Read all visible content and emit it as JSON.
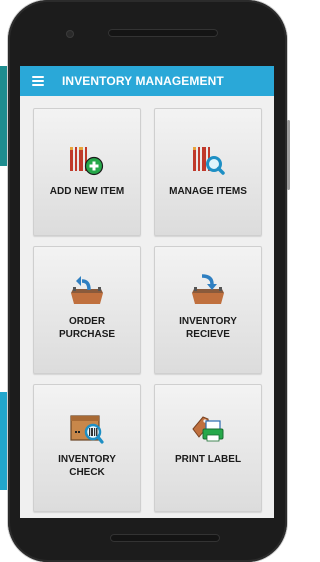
{
  "app": {
    "title": "INVENTORY MANAGEMENT"
  },
  "colors": {
    "app_bar": "#2aa8d8",
    "tile_background": "#e8e8e8",
    "label_text": "#1b1b1b",
    "phone_body": "#1c1c1c"
  },
  "tiles": [
    {
      "label": "ADD NEW ITEM",
      "icon": "barcode-add-icon"
    },
    {
      "label": "MANAGE ITEMS",
      "icon": "barcode-search-icon"
    },
    {
      "label": "ORDER\nPURCHASE",
      "icon": "tray-upload-icon"
    },
    {
      "label": "INVENTORY\nRECIEVE",
      "icon": "tray-download-icon"
    },
    {
      "label": "INVENTORY\nCHECK",
      "icon": "box-scan-icon"
    },
    {
      "label": "PRINT LABEL",
      "icon": "label-print-icon"
    }
  ]
}
